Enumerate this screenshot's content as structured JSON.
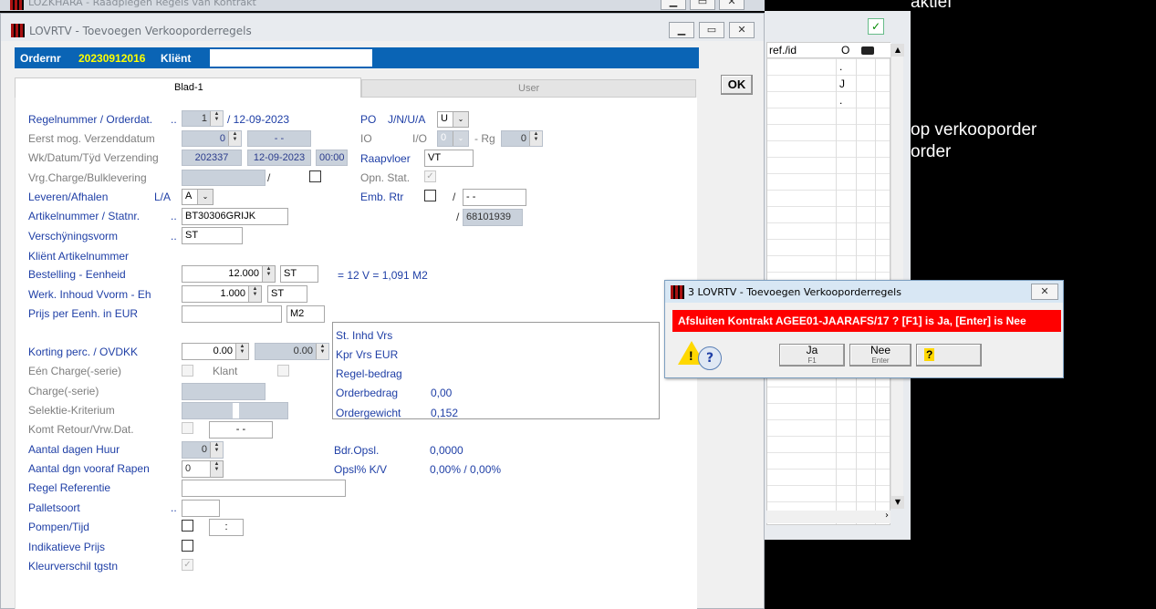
{
  "bg_window": {
    "title": "LOZKHARA - Raadplegen Regels van Kontrakt"
  },
  "right_panel": {
    "col_ref": "ref./id",
    "col_o": "O",
    "rows": [
      ".",
      "J",
      "."
    ]
  },
  "bg_text": {
    "line1": "aktief",
    "line2": "op verkooporder",
    "line3": "order"
  },
  "main_window": {
    "title": "LOVRTV - Toevoegen Verkooporderregels",
    "header": {
      "ordernr_label": "Ordernr",
      "ordernr_value": "20230912016",
      "klient_label": "Kliënt"
    },
    "tabs": [
      "Blad-1",
      "User"
    ],
    "ok_label": "OK",
    "form": {
      "regelnummer_label": "Regelnummer / Orderdat.",
      "regelnummer_dots": "..",
      "regelnummer_value": "1",
      "orderdat": "/ 12-09-2023",
      "eerst_label": "Eerst mog. Verzenddatum",
      "eerst_value": "0",
      "eerst_date": "- -",
      "wk_label": "Wk/Datum/Tÿd Verzending",
      "wk_value": "202337",
      "wk_date": "12-09-2023",
      "wk_time": "00:00",
      "vrg_label": "Vrg.Charge/Bulklevering",
      "vrg_slash": "/",
      "leveren_label": "Leveren/Afhalen",
      "la_label": "L/A",
      "la_value": "A",
      "artikel_label": "Artikelnummer / Statnr.",
      "artikel_dots": "..",
      "artikel_value": "BT30306GRIJK",
      "verschijning_label": "Verschÿningsvorm",
      "verschijning_dots": "..",
      "verschijning_value": "ST",
      "klient_art_label": "Kliënt Artikelnummer",
      "bestelling_label": "Bestelling - Eenheid",
      "bestelling_value": "12.000",
      "bestelling_unit": "ST",
      "bestelling_calc": "= 12 V  = 1,091 M2",
      "werk_label": "Werk. Inhoud Vvorm - Eh",
      "werk_value": "1.000",
      "werk_unit": "ST",
      "prijs_label": "Prijs per Eenh. in EUR",
      "prijs_unit": "M2",
      "korting_label": "Korting perc. / OVDKK",
      "korting_value1": "0.00",
      "korting_value2": "0.00",
      "een_charge_label": "Eén Charge(-serie)",
      "klant_label": "Klant",
      "charge_label": "Charge(-serie)",
      "selektie_label": "Selektie-Kriterium",
      "komt_label": "Komt Retour/Vrw.Dat.",
      "komt_date": "- -",
      "huur_label": "Aantal dagen Huur",
      "huur_value": "0",
      "vooraf_label": "Aantal dgn vooraf Rapen",
      "vooraf_value": "0",
      "regel_ref_label": "Regel Referentie",
      "pallet_label": "Palletsoort",
      "pallet_dots": "..",
      "pompen_label": "Pompen/Tijd",
      "pompen_time": ":",
      "indikatief_label": "Indikatieve Prijs",
      "kleur_label": "Kleurverschil tgstn",
      "po_label": "PO",
      "po_jn": "J/N/U/A",
      "po_value": "U",
      "io_label": "IO",
      "io_io": "I/O",
      "io_value": "0",
      "io_rg": "- Rg",
      "io_rg_value": "0",
      "raapvloer_label": "Raapvloer",
      "raapvloer_value": "VT",
      "opn_label": "Opn. Stat.",
      "emb_label": "Emb. Rtr",
      "emb_slash": "/",
      "emb_date": "- -",
      "stat_slash": "/",
      "stat_value": "68101939"
    },
    "summary": {
      "st_inhd": "St. Inhd Vrs",
      "kpr": "Kpr Vrs  EUR",
      "regel_bedrag": "Regel-bedrag",
      "orderbedrag_label": "Orderbedrag",
      "orderbedrag_value": "0,00",
      "ordergewicht_label": "Ordergewicht",
      "ordergewicht_value": "0,152"
    },
    "bdr_label": "Bdr.Opsl.",
    "bdr_value": "0,0000",
    "opsl_label": "Opsl% K/V",
    "opsl_value": "0,00% / 0,00%"
  },
  "dialog": {
    "title": "3 LOVRTV - Toevoegen Verkooporderregels",
    "message": "Afsluiten Kontrakt AGEE01-JAARAFS/17 ?  [F1] is Ja, [Enter] is Nee",
    "ja_label": "Ja",
    "ja_key": "F1",
    "nee_label": "Nee",
    "nee_key": "Enter",
    "help_label": "?"
  },
  "colors": {
    "header_blue": "#0a64b5",
    "ordernr_yellow": "#ffff00",
    "label_blue": "#1f3fa6",
    "alert_red": "#ff0000"
  }
}
